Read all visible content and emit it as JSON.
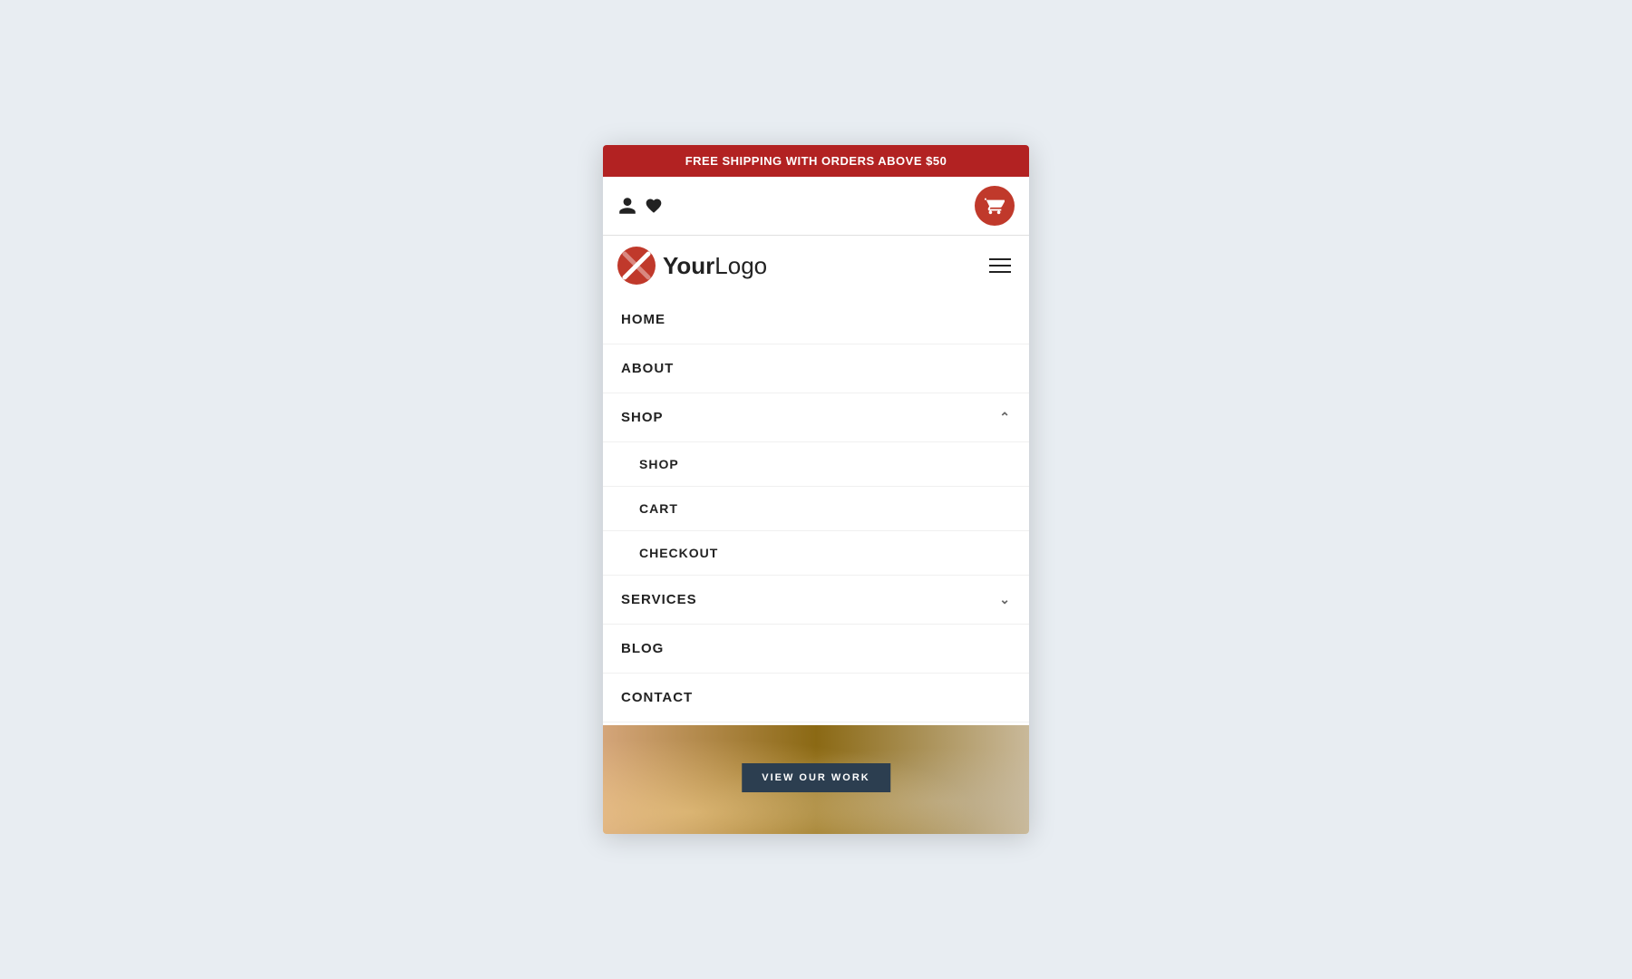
{
  "announcement": {
    "text": "FREE SHIPPING WITH ORDERS ABOVE $50"
  },
  "header": {
    "cart_button_label": "Cart",
    "logo_bold": "Your",
    "logo_light": "Logo",
    "hamburger_label": "Menu"
  },
  "nav": {
    "items": [
      {
        "label": "HOME",
        "has_submenu": false,
        "expanded": false
      },
      {
        "label": "ABOUT",
        "has_submenu": false,
        "expanded": false
      },
      {
        "label": "SHOP",
        "has_submenu": true,
        "expanded": true
      },
      {
        "label": "SERVICES",
        "has_submenu": true,
        "expanded": false
      },
      {
        "label": "BLOG",
        "has_submenu": false,
        "expanded": false
      },
      {
        "label": "CONTACT",
        "has_submenu": false,
        "expanded": false
      }
    ],
    "shop_subitems": [
      {
        "label": "SHOP"
      },
      {
        "label": "CART"
      },
      {
        "label": "CHECKOUT"
      }
    ]
  },
  "hero": {
    "cta_label": "VIEW OUR WORK"
  },
  "colors": {
    "accent_red": "#b22222",
    "cart_red": "#c0392b",
    "dark_navy": "#2c3e50"
  }
}
